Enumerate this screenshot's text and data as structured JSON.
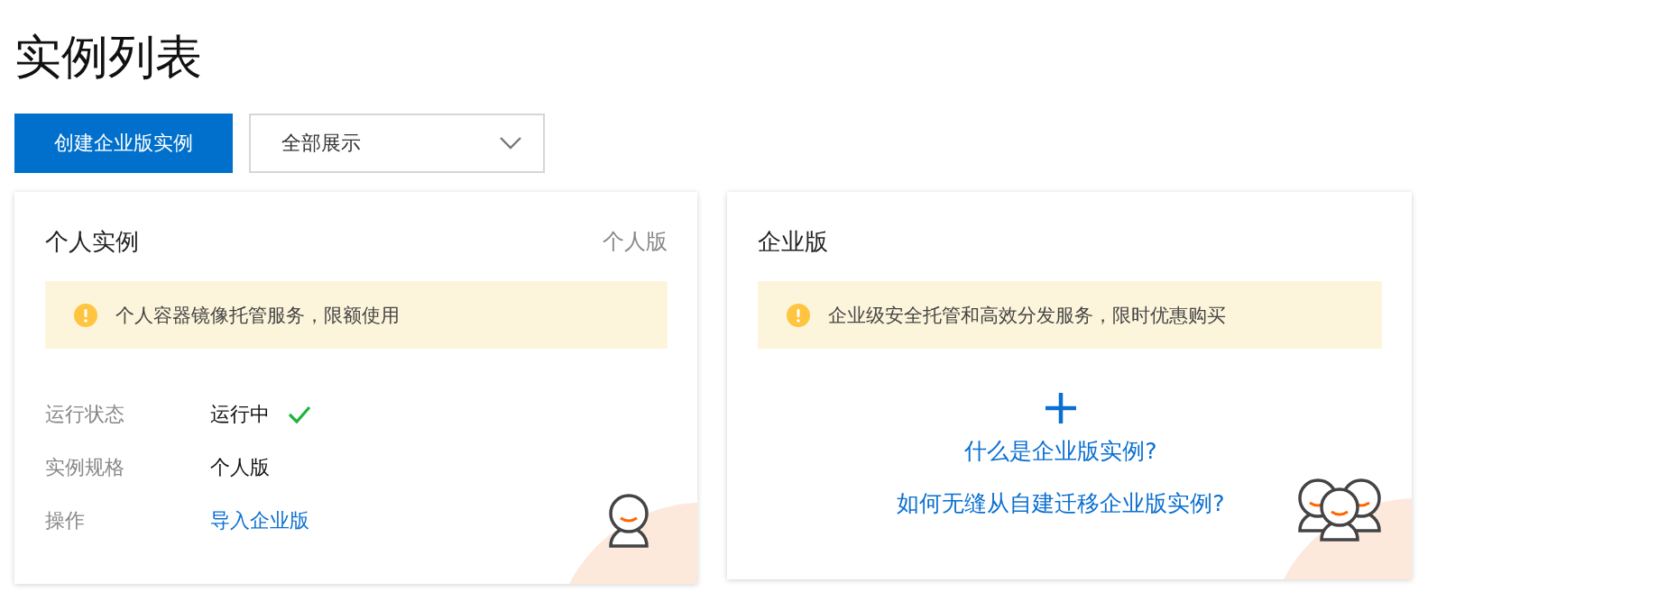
{
  "page_title": "实例列表",
  "toolbar": {
    "create_button": "创建企业版实例",
    "filter": {
      "value": "全部展示"
    }
  },
  "cards": [
    {
      "kind": "personal",
      "title": "个人实例",
      "tag": "个人版",
      "notice": "个人容器镜像托管服务，限额使用",
      "fields": [
        {
          "label": "运行状态",
          "value": "运行中",
          "kind": "status",
          "ok": true
        },
        {
          "label": "实例规格",
          "value": "个人版",
          "kind": "text"
        },
        {
          "label": "操作",
          "value": "导入企业版",
          "kind": "link"
        }
      ]
    },
    {
      "kind": "enterprise",
      "title": "企业版",
      "notice": "企业级安全托管和高效分发服务，限时优惠购买",
      "links": [
        "什么是企业版实例?",
        "如何无缝从自建迁移企业版实例?"
      ]
    }
  ]
}
